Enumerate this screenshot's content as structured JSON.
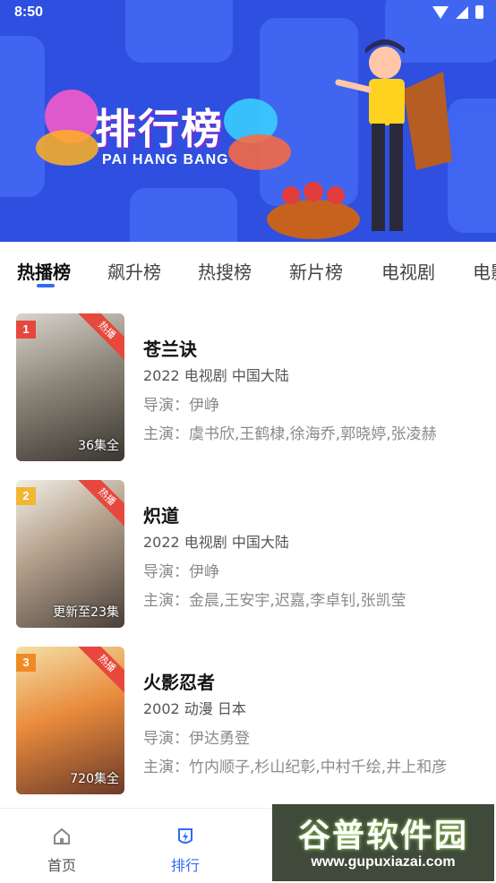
{
  "status_bar": {
    "time": "8:50"
  },
  "banner": {
    "title": "排行榜",
    "subtitle": "PAI HANG BANG"
  },
  "tabs": [
    {
      "label": "热播榜"
    },
    {
      "label": "飙升榜"
    },
    {
      "label": "热搜榜"
    },
    {
      "label": "新片榜"
    },
    {
      "label": "电视剧"
    },
    {
      "label": "电影"
    }
  ],
  "items": [
    {
      "rank": "1",
      "badge": "热播",
      "episodes": "36集全",
      "title": "苍兰诀",
      "meta": "2022  电视剧  中国大陆",
      "director": "导演：伊峥",
      "cast": "主演：虞书欣,王鹤棣,徐海乔,郭晓婷,张凌赫",
      "rank_color": "#e6483d"
    },
    {
      "rank": "2",
      "badge": "热播",
      "episodes": "更新至23集",
      "title": "炽道",
      "meta": "2022  电视剧  中国大陆",
      "director": "导演：伊峥",
      "cast": "主演：金晨,王安宇,迟嘉,李卓钊,张凯莹",
      "rank_color": "#f2b632"
    },
    {
      "rank": "3",
      "badge": "热播",
      "episodes": "720集全",
      "title": "火影忍者",
      "meta": "2002  动漫  日本",
      "director": "导演：伊达勇登",
      "cast": "主演：竹内顺子,杉山纪彰,中村千绘,井上和彦",
      "rank_color": "#f08a24"
    }
  ],
  "bottom_nav": [
    {
      "label": "首页",
      "icon": "home-icon"
    },
    {
      "label": "排行",
      "icon": "ranking-icon"
    }
  ],
  "watermark": {
    "text": "谷普软件园",
    "url": "www.gupuxiazai.com"
  },
  "colors": {
    "accent": "#2f6bf5",
    "banner": "#2e4fe0",
    "hot": "#e6483d"
  }
}
